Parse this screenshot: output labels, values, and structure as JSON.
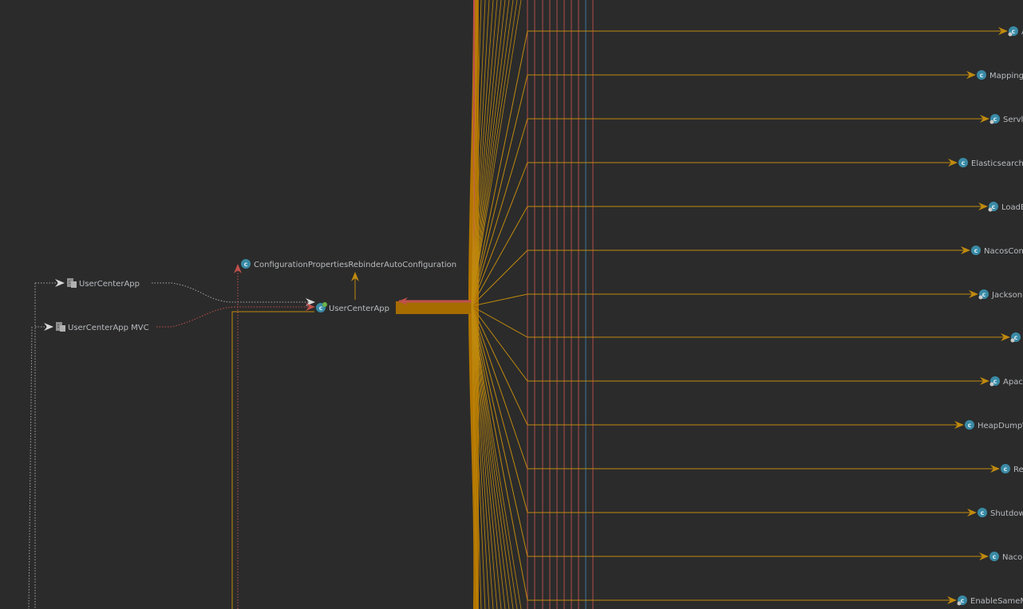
{
  "colors": {
    "background": "#2b2b2b",
    "edge": "#c08a0e",
    "edge_bundle": "#a66c00",
    "edge_red": "#c0504d",
    "edge_blue": "#3f7fa8",
    "dotted_edge": "#a8a8a8",
    "class_icon": "#3a8aa5",
    "label": "#b9bcc0"
  },
  "nodes": {
    "center_config": {
      "label": "ConfigurationPropertiesRebinderAutoConfiguration",
      "icon": "class-icon"
    },
    "center_app": {
      "label": "UserCenterApp",
      "icon": "spring-boot-class-icon"
    },
    "module_app": {
      "label": "UserCenterApp",
      "icon": "module-icon"
    },
    "module_mvc": {
      "label": "UserCenterApp MVC",
      "icon": "module-icon"
    }
  },
  "right_nodes": [
    {
      "label": "A",
      "icon": "bean-class-icon"
    },
    {
      "label": "Mapping",
      "icon": "class-icon"
    },
    {
      "label": "Servl",
      "icon": "bean-class-icon"
    },
    {
      "label": "Elasticsearch",
      "icon": "class-icon"
    },
    {
      "label": "LoadB",
      "icon": "bean-class-icon"
    },
    {
      "label": "NacosCon",
      "icon": "class-icon"
    },
    {
      "label": "Jackson(",
      "icon": "bean-class-icon"
    },
    {
      "label": "",
      "icon": "bean-class-icon"
    },
    {
      "label": "Apac",
      "icon": "bean-class-icon"
    },
    {
      "label": "HeapDump\\",
      "icon": "class-icon"
    },
    {
      "label": "Re",
      "icon": "class-icon"
    },
    {
      "label": "Shutdow",
      "icon": "class-icon"
    },
    {
      "label": "Naco",
      "icon": "class-icon"
    },
    {
      "label": "EnableSameM",
      "icon": "bean-class-icon"
    }
  ]
}
